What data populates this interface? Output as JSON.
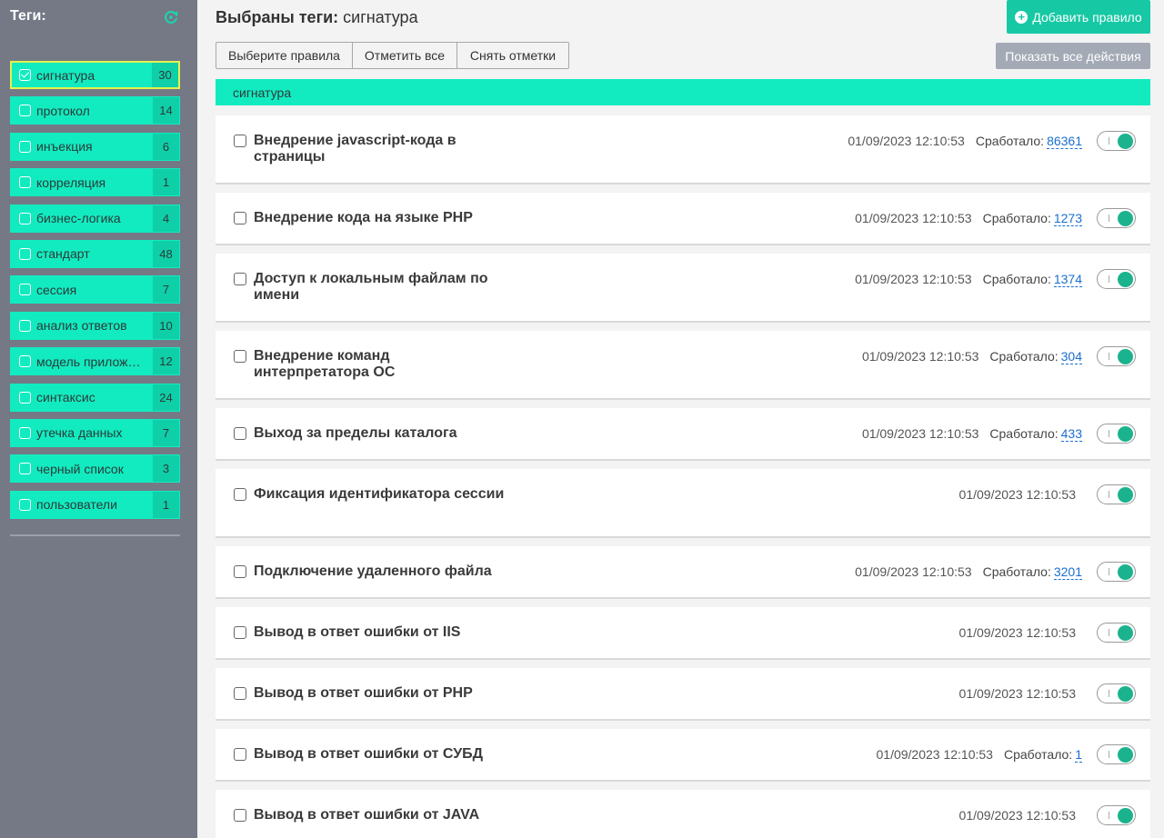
{
  "sidebar": {
    "title": "Теги:",
    "refresh_icon": "refresh-icon",
    "tags": [
      {
        "label": "сигнатура",
        "count": "30",
        "selected": true
      },
      {
        "label": "протокол",
        "count": "14",
        "selected": false
      },
      {
        "label": "инъекция",
        "count": "6",
        "selected": false
      },
      {
        "label": "корреляция",
        "count": "1",
        "selected": false
      },
      {
        "label": "бизнес-логика",
        "count": "4",
        "selected": false
      },
      {
        "label": "стандарт",
        "count": "48",
        "selected": false
      },
      {
        "label": "сессия",
        "count": "7",
        "selected": false
      },
      {
        "label": "анализ ответов",
        "count": "10",
        "selected": false
      },
      {
        "label": "модель приложения",
        "count": "12",
        "selected": false
      },
      {
        "label": "синтаксис",
        "count": "24",
        "selected": false
      },
      {
        "label": "утечка данных",
        "count": "7",
        "selected": false
      },
      {
        "label": "черный список",
        "count": "3",
        "selected": false
      },
      {
        "label": "пользователи",
        "count": "1",
        "selected": false
      }
    ]
  },
  "header": {
    "title_bold": "Выбраны теги:",
    "title_value": "сигнатура",
    "add_rule_label": "Добавить правило",
    "select_rules_label": "Выберите правила",
    "mark_all_label": "Отметить все",
    "unmark_label": "Снять отметки",
    "show_all_actions_label": "Показать все действия"
  },
  "group": {
    "label": "сигнатура"
  },
  "rules": [
    {
      "name": "Внедрение javascript-кода в страницы",
      "date": "01/09/2023 12:10:53",
      "fired_label": "Сработало:",
      "fired_count": "86361",
      "enabled": true,
      "tall": true
    },
    {
      "name": "Внедрение кода на языке PHP",
      "date": "01/09/2023 12:10:53",
      "fired_label": "Сработало:",
      "fired_count": "1273",
      "enabled": true,
      "tall": false
    },
    {
      "name": "Доступ к локальным файлам по имени",
      "date": "01/09/2023 12:10:53",
      "fired_label": "Сработало:",
      "fired_count": "1374",
      "enabled": true,
      "tall": true
    },
    {
      "name": "Внедрение команд интерпретатора ОС",
      "date": "01/09/2023 12:10:53",
      "fired_label": "Сработало:",
      "fired_count": "304",
      "enabled": true,
      "tall": true
    },
    {
      "name": "Выход за пределы каталога",
      "date": "01/09/2023 12:10:53",
      "fired_label": "Сработало:",
      "fired_count": "433",
      "enabled": true,
      "tall": false
    },
    {
      "name": "Фиксация идентификатора сессии",
      "date": "01/09/2023 12:10:53",
      "fired_label": "",
      "fired_count": "",
      "enabled": true,
      "tall": true
    },
    {
      "name": "Подключение удаленного файла",
      "date": "01/09/2023 12:10:53",
      "fired_label": "Сработало:",
      "fired_count": "3201",
      "enabled": true,
      "tall": false
    },
    {
      "name": "Вывод в ответ ошибки от IIS",
      "date": "01/09/2023 12:10:53",
      "fired_label": "",
      "fired_count": "",
      "enabled": true,
      "tall": false
    },
    {
      "name": "Вывод в ответ ошибки от PHP",
      "date": "01/09/2023 12:10:53",
      "fired_label": "",
      "fired_count": "",
      "enabled": true,
      "tall": false
    },
    {
      "name": "Вывод в ответ ошибки от СУБД",
      "date": "01/09/2023 12:10:53",
      "fired_label": "Сработало:",
      "fired_count": "1",
      "enabled": true,
      "tall": false
    },
    {
      "name": "Вывод в ответ ошибки от JAVA",
      "date": "01/09/2023 12:10:53",
      "fired_label": "",
      "fired_count": "",
      "enabled": true,
      "tall": false
    }
  ],
  "colors": {
    "accent": "#12ebc0",
    "accent_dark": "#0fcfa8",
    "button_green": "#17c8a5",
    "sidebar_bg": "#747985",
    "selected_border": "#e3f24d",
    "toggle_on": "#1bb38e",
    "link": "#1a6fcf"
  }
}
